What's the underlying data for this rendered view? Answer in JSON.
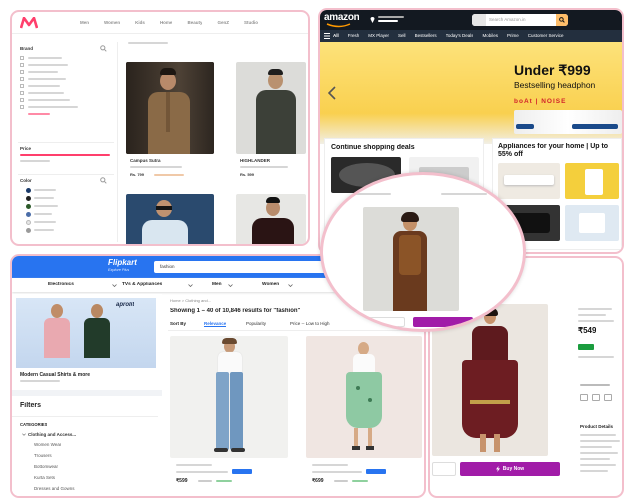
{
  "myntra": {
    "nav": [
      "Men",
      "Women",
      "Kids",
      "Home",
      "Beauty",
      "GenZ",
      "Studio"
    ],
    "filters_title": "Brand",
    "brands": [
      "",
      "",
      "",
      "",
      "",
      "",
      "",
      "",
      ""
    ],
    "price_title": "Price",
    "color_title": "Color",
    "colors": [
      "",
      "",
      "",
      "",
      "",
      ""
    ],
    "products": [
      {
        "name": "Campus Sutra",
        "desc": "",
        "price": "Rs. 799",
        "tag": ""
      },
      {
        "name": "HIGHLANDER",
        "desc": "",
        "price": "Rs. 599",
        "tag": ""
      }
    ]
  },
  "amazon": {
    "logo": "amazon",
    "search_placeholder": "Search Amazon.in",
    "nav": [
      "All",
      "Fresh",
      "MX Player",
      "Sell",
      "Bestsellers",
      "Today's Deals",
      "Mobiles",
      "Prime",
      "Customer Service"
    ],
    "hero_title": "Under ₹999",
    "hero_subtitle": "Bestselling headphon",
    "hero_brand": "boAt | NOISE",
    "deals_title": "Continue shopping deals",
    "appliances_title": "Appliances for your home | Up to 55% off"
  },
  "flipkart": {
    "logo": "Flipkart",
    "logo_sub": "Explore Plus",
    "search_value": "fashion",
    "categories": [
      "Electronics",
      "TVs & Appliances",
      "Men",
      "Women"
    ],
    "banner_brand": "aprolit",
    "banner_title": "Modern Casual Shirts & more",
    "banner_sub": "",
    "filters_title": "Filters",
    "category_title": "CATEGORIES",
    "category_items": [
      "Clothing and Access...",
      "Women Wear",
      "Trousers",
      "Bottomwear",
      "Kurta Sets",
      "Dresses and Gowns"
    ],
    "breadcrumb": "Home > Clothing and...",
    "results_title": "Showing 1 – 40 of 10,846 results for \"fashion\"",
    "sort_label": "Sort By",
    "sort_options": [
      "Relevance",
      "Popularity",
      "Price -- Low to High"
    ],
    "products": [
      {
        "brand": "",
        "name": "",
        "price": "₹599"
      },
      {
        "brand": "",
        "name": "",
        "price": "₹699"
      }
    ]
  },
  "detail": {
    "button": "Buy Now",
    "price": "₹549",
    "badge": "",
    "side_title": "Product Details"
  },
  "colors": {
    "myntra_pink": "#ff3f6c",
    "amazon_dark": "#131921",
    "amazon_nav": "#232f3e",
    "flipkart_blue": "#2874f0",
    "flipkart_yellow": "#ffe11b",
    "card_border": "#f3bfcc",
    "buy_now": "#a11ca8"
  }
}
